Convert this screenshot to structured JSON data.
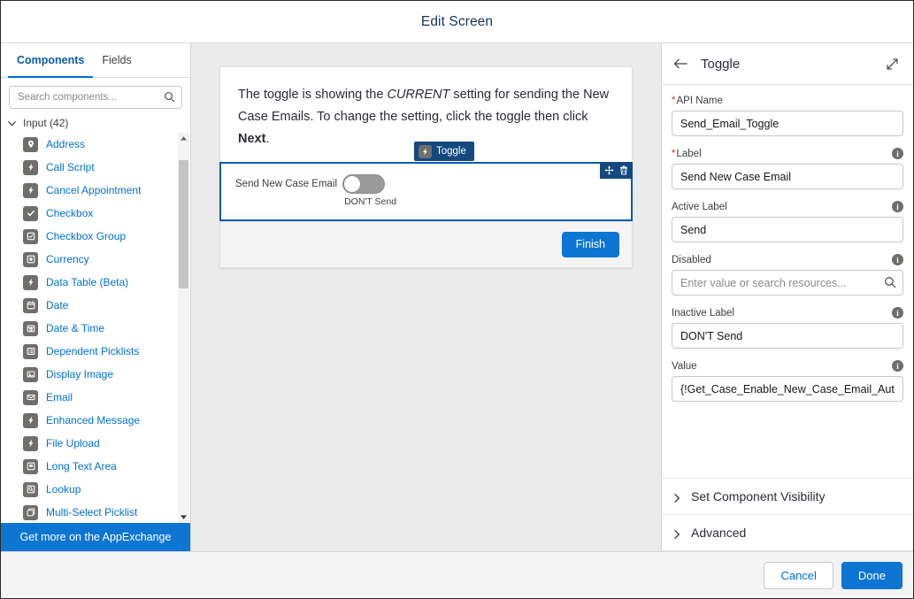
{
  "header": {
    "title": "Edit Screen"
  },
  "palette": {
    "tabs": [
      {
        "label": "Components",
        "active": true
      },
      {
        "label": "Fields",
        "active": false
      }
    ],
    "search": {
      "placeholder": "Search components...",
      "value": "",
      "icon": "search-icon"
    },
    "section": {
      "label": "Input (42)",
      "expanded": true,
      "chevron": "chevron-down-icon"
    },
    "items": [
      {
        "label": "Address",
        "icon": "location-pin-icon"
      },
      {
        "label": "Call Script",
        "icon": "lightning-bolt-icon"
      },
      {
        "label": "Cancel Appointment",
        "icon": "lightning-bolt-icon"
      },
      {
        "label": "Checkbox",
        "icon": "checkmark-icon"
      },
      {
        "label": "Checkbox Group",
        "icon": "checkbox-group-icon"
      },
      {
        "label": "Currency",
        "icon": "currency-icon"
      },
      {
        "label": "Data Table (Beta)",
        "icon": "lightning-bolt-icon"
      },
      {
        "label": "Date",
        "icon": "calendar-icon"
      },
      {
        "label": "Date & Time",
        "icon": "date-time-icon"
      },
      {
        "label": "Dependent Picklists",
        "icon": "list-icon"
      },
      {
        "label": "Display Image",
        "icon": "image-icon"
      },
      {
        "label": "Email",
        "icon": "envelope-icon"
      },
      {
        "label": "Enhanced Message",
        "icon": "lightning-bolt-icon"
      },
      {
        "label": "File Upload",
        "icon": "lightning-bolt-icon"
      },
      {
        "label": "Long Text Area",
        "icon": "text-area-icon"
      },
      {
        "label": "Lookup",
        "icon": "lookup-icon"
      },
      {
        "label": "Multi-Select Picklist",
        "icon": "multi-picklist-icon"
      }
    ],
    "appexchange_label": "Get more on the AppExchange",
    "scroll_up_icon": "triangle-up-icon",
    "scroll_down_icon": "triangle-down-icon"
  },
  "canvas": {
    "text_part1": "The toggle is showing the ",
    "text_emphasis": "CURRENT",
    "text_part2": " setting for sending the New Case Emails. To change the setting, click the toggle then click ",
    "text_bold": "Next",
    "text_part3": ".",
    "component_badge": {
      "label": "Toggle",
      "icon": "lightning-bolt-icon"
    },
    "actions": [
      {
        "name": "move-handle",
        "icon": "move-icon"
      },
      {
        "name": "delete-component",
        "icon": "trash-icon"
      }
    ],
    "toggle": {
      "label": "Send New Case Email",
      "state_label": "DON'T Send",
      "checked": false
    },
    "finish_label": "Finish"
  },
  "properties": {
    "title": "Toggle",
    "back_icon": "arrow-left-icon",
    "expand_icon": "expand-diagonal-icon",
    "info_icon_char": "i",
    "fields": [
      {
        "label": "API Name",
        "required": true,
        "value": "Send_Email_Toggle",
        "placeholder": "",
        "has_info": false,
        "has_search": false
      },
      {
        "label": "Label",
        "required": true,
        "value": "Send New Case Email",
        "placeholder": "",
        "has_info": true,
        "has_search": false
      },
      {
        "label": "Active Label",
        "required": false,
        "value": "Send",
        "placeholder": "",
        "has_info": true,
        "has_search": false
      },
      {
        "label": "Disabled",
        "required": false,
        "value": "",
        "placeholder": "Enter value or search resources...",
        "has_info": true,
        "has_search": true
      },
      {
        "label": "Inactive Label",
        "required": false,
        "value": "DON'T Send",
        "placeholder": "",
        "has_info": true,
        "has_search": false
      },
      {
        "label": "Value",
        "required": false,
        "value": "{!Get_Case_Enable_New_Case_Email_Autom",
        "placeholder": "",
        "has_info": true,
        "has_search": false
      }
    ],
    "accordions": [
      {
        "label": "Set Component Visibility",
        "expanded": false
      },
      {
        "label": "Advanced",
        "expanded": false
      }
    ]
  },
  "footer": {
    "cancel_label": "Cancel",
    "done_label": "Done"
  },
  "colors": {
    "brand_blue": "#0d76d3",
    "link_blue": "#0070d2",
    "selection_blue": "#0b5cab",
    "badge_navy": "#14487f",
    "icon_gray": "#706e6b",
    "required_red": "#c23934",
    "canvas_bg": "#ebebeb"
  }
}
